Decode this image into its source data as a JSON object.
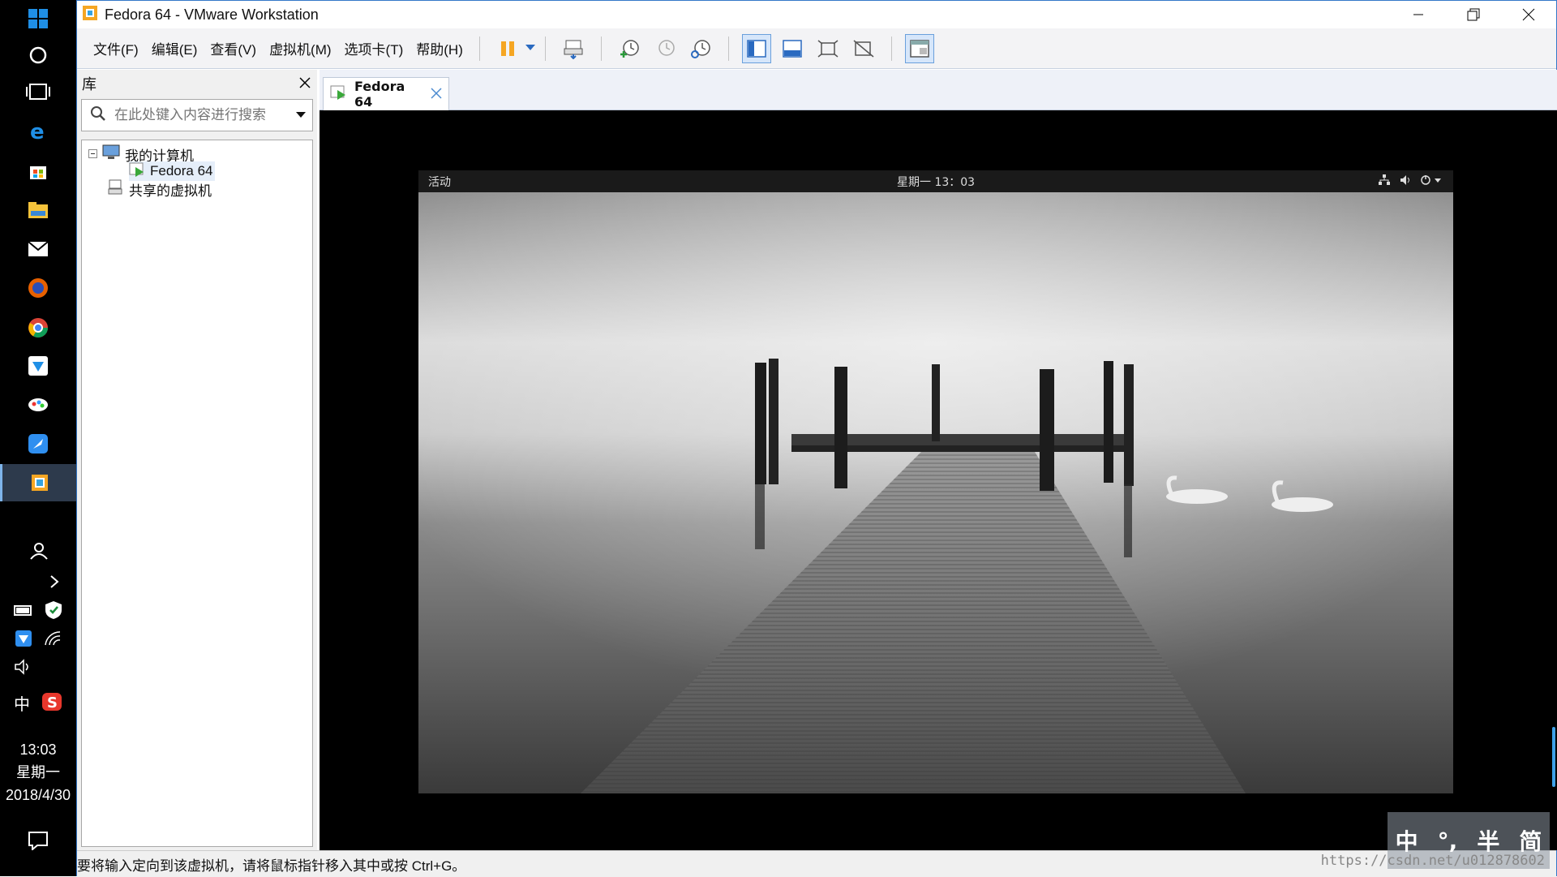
{
  "window": {
    "title": "Fedora 64 - VMware Workstation"
  },
  "menu": [
    "文件(F)",
    "编辑(E)",
    "查看(V)",
    "虚拟机(M)",
    "选项卡(T)",
    "帮助(H)"
  ],
  "library": {
    "title": "库",
    "search_placeholder": "在此处键入内容进行搜索",
    "tree": {
      "root": "我的计算机",
      "vm": "Fedora 64",
      "shared": "共享的虚拟机"
    }
  },
  "tab": {
    "label": "Fedora 64"
  },
  "guest": {
    "activities": "活动",
    "clock": "星期一 13：03"
  },
  "status": {
    "message": "要将输入定向到该虚拟机，请将鼠标指针移入其中或按 Ctrl+G。"
  },
  "taskbar": {
    "time": "13:03",
    "weekday": "星期一",
    "date": "2018/4/30",
    "ime": "中"
  },
  "ime_overlay": {
    "k1": "中",
    "k2": "°,",
    "k3": "半",
    "k4": "简"
  },
  "watermark": "https://csdn.net/u012878602",
  "colors": {
    "accent": "#3478c8",
    "taskbar": "#000000"
  }
}
